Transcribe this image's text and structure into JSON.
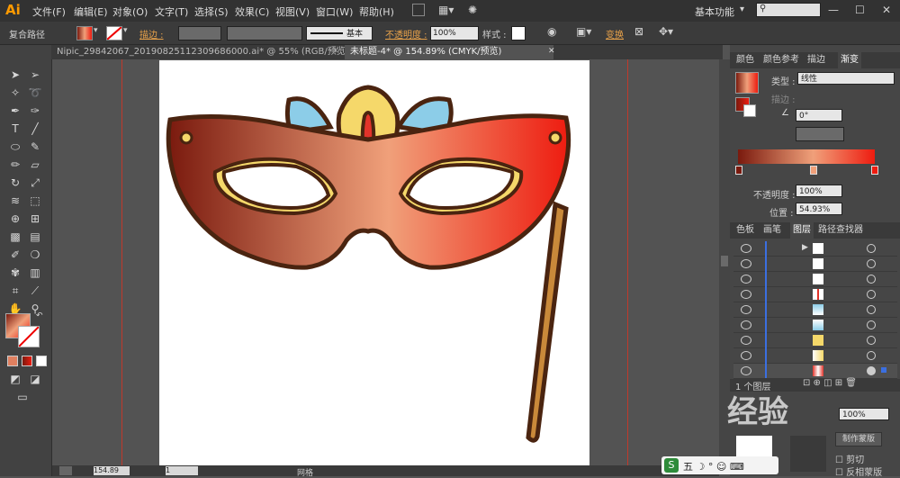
{
  "app": {
    "logo": "Ai"
  },
  "menu": [
    "文件(F)",
    "编辑(E)",
    "对象(O)",
    "文字(T)",
    "选择(S)",
    "效果(C)",
    "视图(V)",
    "窗口(W)",
    "帮助(H)"
  ],
  "workspace": "基本功能",
  "control": {
    "selection_label": "复合路径",
    "stroke_label": "描边 :",
    "stroke_style": "基本",
    "opacity_label": "不透明度 :",
    "opacity_value": "100%",
    "style_label": "样式 :",
    "transform_label": "变换"
  },
  "tabs": [
    {
      "label": "Nipic_29842067_20190825112309686000.ai* @ 55% (RGB/预览)"
    },
    {
      "label": "未标题-4* @ 154.89% (CMYK/预览)"
    }
  ],
  "gradient_panel": {
    "tabs": [
      "颜色",
      "颜色参考",
      "描边",
      "渐变"
    ],
    "type_label": "类型 :",
    "type_value": "线性",
    "stroke_label": "描边 :",
    "angle_value": "0°",
    "opacity_label": "不透明度 :",
    "opacity_value": "100%",
    "position_label": "位置 :",
    "position_value": "54.93%",
    "colors": {
      "dark": "#7a1a0e",
      "mid": "#f0a07a",
      "bright": "#ee1c10"
    }
  },
  "layers_panel": {
    "tabs": [
      "色板",
      "画笔",
      "图层",
      "路径查找器"
    ],
    "footer_count": "1 个图层"
  },
  "bottom_panel": {
    "items": [
      "剪切",
      "反相蒙版"
    ],
    "button": "制作蒙版",
    "opacity": "100%"
  },
  "status": {
    "zoom": "154.89",
    "page": "1",
    "mode": "网格"
  },
  "watermark": "经验"
}
